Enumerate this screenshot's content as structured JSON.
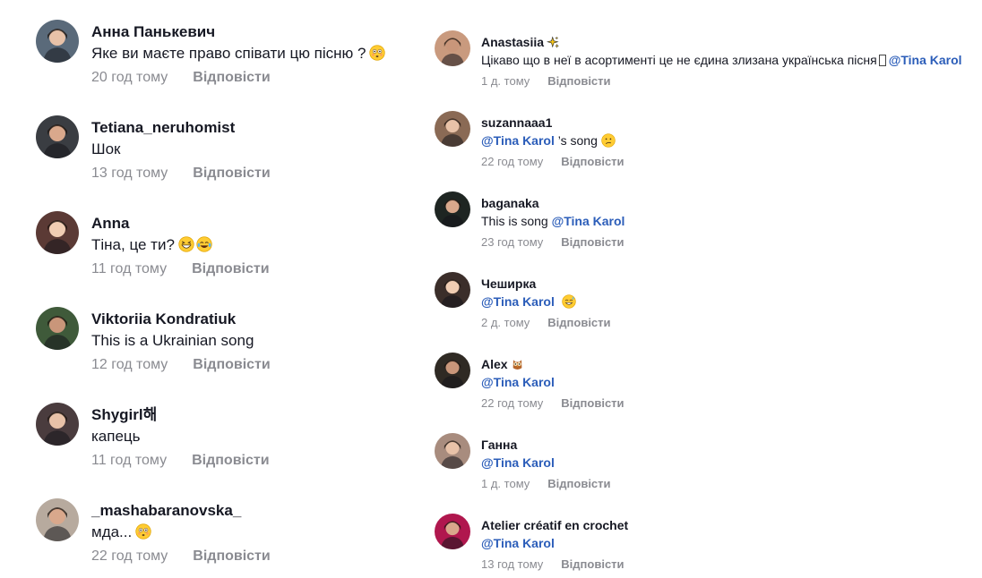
{
  "left_comments": [
    {
      "username": "Анна Панькевич",
      "text": "Яке ви маєте право співати цю пісню ?",
      "emoji": [
        "flushed-face"
      ],
      "time": "20 год тому",
      "reply": "Відповісти",
      "avatar_color": "#5a6a7a"
    },
    {
      "username": "Tetiana_neruhomist",
      "text": "Шок",
      "emoji": [],
      "time": "13 год тому",
      "reply": "Відповісти",
      "avatar_color": "#3a3d42"
    },
    {
      "username": "Anna",
      "text": "Тіна, це ти?",
      "emoji": [
        "grinning-squint-face",
        "tears-of-joy-face"
      ],
      "time": "11 год тому",
      "reply": "Відповісти",
      "avatar_color": "#5b3a35"
    },
    {
      "username": "Viktoriia Kondratiuk",
      "text": "This is a Ukrainian song",
      "emoji": [],
      "time": "12 год тому",
      "reply": "Відповісти",
      "avatar_color": "#3f5a3a"
    },
    {
      "username": "Shygirl해",
      "text": "капець",
      "emoji": [],
      "time": "11 год тому",
      "reply": "Відповісти",
      "avatar_color": "#4a3c3e"
    },
    {
      "username": "_mashabaranovska_",
      "text": "мда...",
      "emoji": [
        "flushed-face"
      ],
      "time": "22 год тому",
      "reply": "Відповісти",
      "avatar_color": "#b7aa9e"
    }
  ],
  "right_comments": [
    {
      "username": "Anastasiia",
      "name_emoji": "sparkles",
      "text": "Цікаво що в неї в асортименті це не єдина злизана українська пісня",
      "tofu": true,
      "mention": "@Tina Karol",
      "mention_first": false,
      "text_after": "",
      "emoji": [],
      "time": "1 д. тому",
      "reply": "Відповісти",
      "avatar_color": "#c99a7e"
    },
    {
      "username": "suzannaaa1",
      "name_emoji": "",
      "text": "",
      "mention": "@Tina Karol",
      "mention_first": true,
      "text_after": " ’s song",
      "emoji": [
        "confused-face"
      ],
      "time": "22 год тому",
      "reply": "Відповісти",
      "avatar_color": "#8a6a55"
    },
    {
      "username": "baganaka",
      "name_emoji": "",
      "text": "This is song ",
      "mention": "@Tina Karol",
      "mention_first": false,
      "text_after": "",
      "emoji": [],
      "time": "23 год тому",
      "reply": "Відповісти",
      "avatar_color": "#1e2522"
    },
    {
      "username": "Чеширка",
      "name_emoji": "",
      "text": "",
      "mention": "@Tina Karol",
      "mention_first": true,
      "text_after": " ",
      "emoji": [
        "sweat-smile-face"
      ],
      "time": "2 д. тому",
      "reply": "Відповісти",
      "avatar_color": "#3b2e2a"
    },
    {
      "username": "Alex",
      "name_emoji": "owl",
      "text": "",
      "mention": "@Tina Karol",
      "mention_first": true,
      "text_after": "",
      "emoji": [],
      "time": "22 год тому",
      "reply": "Відповісти",
      "avatar_color": "#2f2a24"
    },
    {
      "username": "Ганна",
      "name_emoji": "",
      "text": "",
      "mention": "@Tina Karol",
      "mention_first": true,
      "text_after": "",
      "emoji": [],
      "time": "1 д. тому",
      "reply": "Відповісти",
      "avatar_color": "#a88c7e"
    },
    {
      "username": "Atelier créatif en crochet",
      "name_emoji": "",
      "text": "",
      "mention": "@Tina Karol",
      "mention_first": true,
      "text_after": "",
      "emoji": [],
      "time": "13 год тому",
      "reply": "Відповісти",
      "avatar_color": "#b0174e"
    }
  ],
  "colors": {
    "mention": "#2b5db9",
    "meta": "#8a8b91",
    "text": "#161823"
  }
}
